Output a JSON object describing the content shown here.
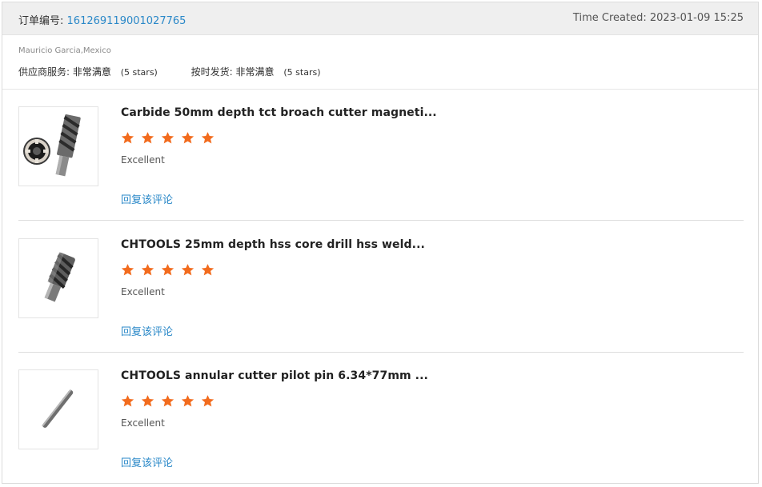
{
  "order": {
    "number_label": "订单编号:",
    "number": "161269119001027765",
    "time_label": "Time Created:",
    "time": "2023-01-09 15:25"
  },
  "buyer": {
    "name_location": "Mauricio Garcia,Mexico"
  },
  "ratings": [
    {
      "label": "供应商服务:",
      "value": "非常满意",
      "stars": "(5 stars)"
    },
    {
      "label": "按时发货:",
      "value": "非常满意",
      "stars": "(5 stars)"
    }
  ],
  "products": [
    {
      "title": "Carbide 50mm depth tct broach cutter magneti...",
      "rating": 5,
      "review": "Excellent",
      "reply_label": "回复该评论",
      "image": "annular-cutter-tct-image"
    },
    {
      "title": "CHTOOLS 25mm depth hss core drill hss weld...",
      "rating": 5,
      "review": "Excellent",
      "reply_label": "回复该评论",
      "image": "hss-core-drill-image"
    },
    {
      "title": "CHTOOLS annular cutter pilot pin 6.34*77mm ...",
      "rating": 5,
      "review": "Excellent",
      "reply_label": "回复该评论",
      "image": "pilot-pin-image"
    }
  ],
  "colors": {
    "link": "#2a88c8",
    "star": "#f26b1d",
    "header_bg": "#efefef"
  }
}
